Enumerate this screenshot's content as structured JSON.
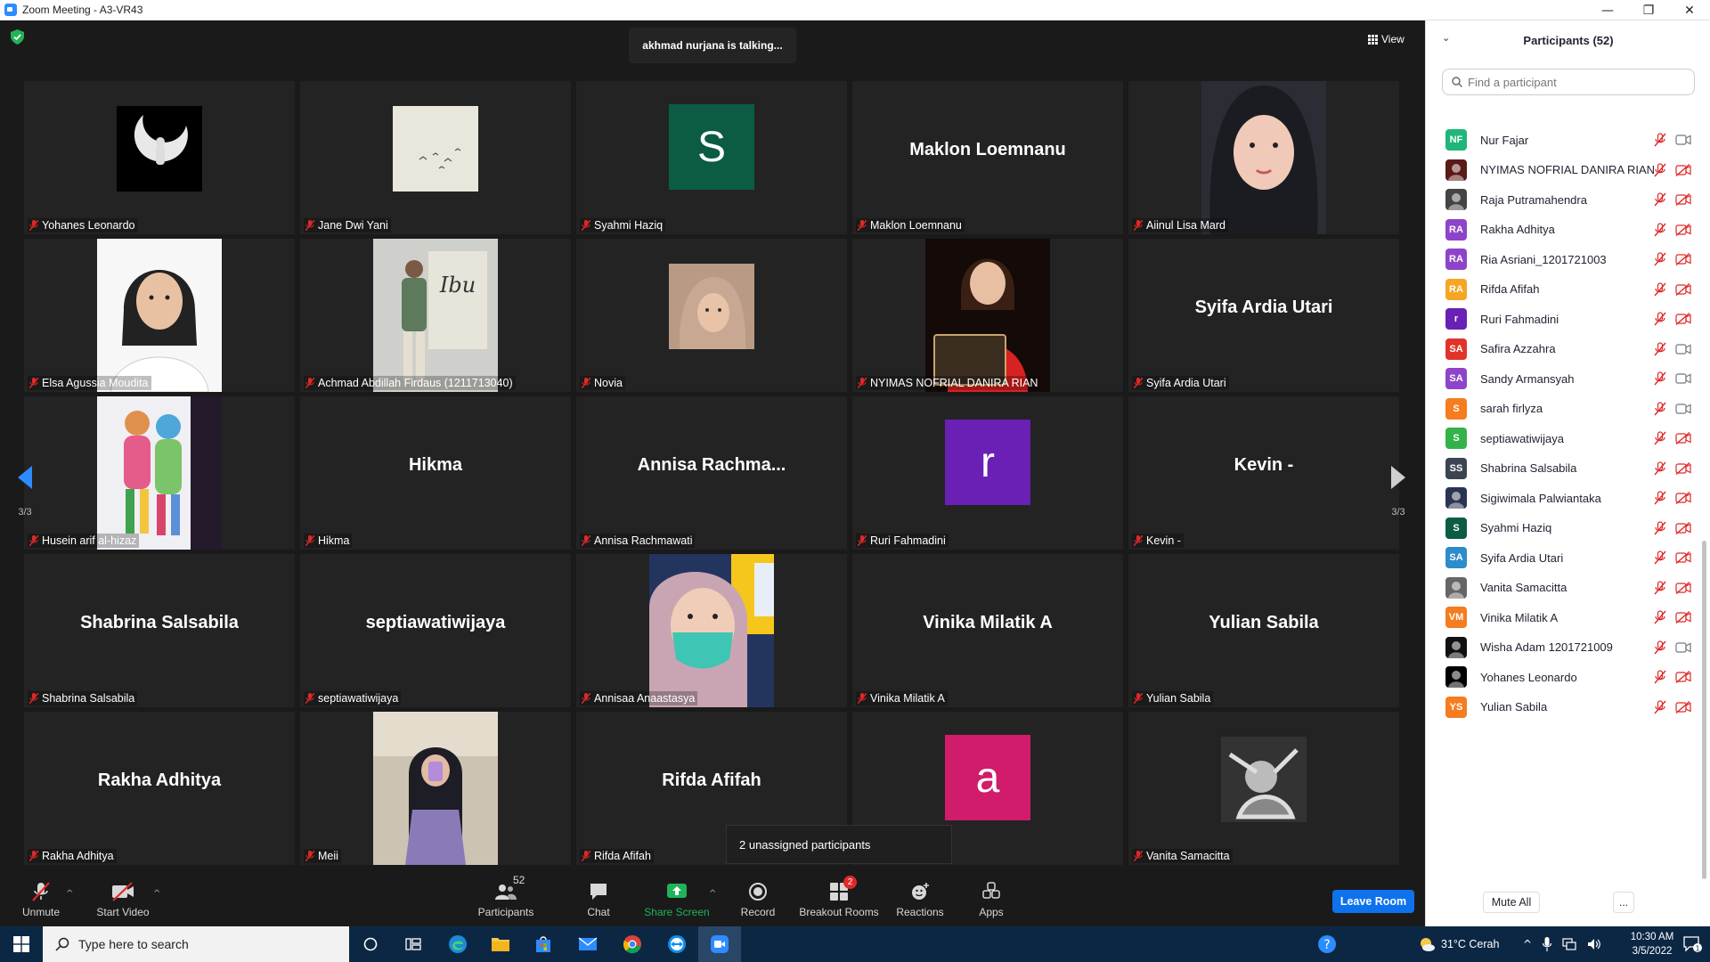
{
  "window": {
    "title": "Zoom Meeting - A3-VR43",
    "controls": [
      "—",
      "❐",
      "✕"
    ]
  },
  "meeting": {
    "talking": "akhmad nurjana is talking...",
    "view_label": "View",
    "page_indicator_left": "3/3",
    "page_indicator_right": "3/3",
    "unassigned_tooltip": "2 unassigned participants"
  },
  "tiles": [
    {
      "label": "Yohanes Leonardo",
      "kind": "thumb",
      "bg": "#000000",
      "art": "moon"
    },
    {
      "label": "Jane Dwi Yani",
      "kind": "thumb",
      "bg": "#e9e6dc",
      "art": "birds"
    },
    {
      "label": "Syahmi Haziq",
      "kind": "letter",
      "letter": "S",
      "bg": "#0b5b45"
    },
    {
      "label": "Maklon Loemnanu",
      "kind": "name",
      "display": "Maklon Loemnanu"
    },
    {
      "label": "Aiinul Lisa Mard",
      "kind": "photo",
      "bg": "#2b2d35",
      "art": "hijab-dark"
    },
    {
      "label": "Elsa Agussia Moudita",
      "kind": "photo",
      "bg": "#f4f4f4",
      "art": "portrait-white"
    },
    {
      "label": "Achmad Abdillah Firdaus (1211713040)",
      "kind": "photo",
      "bg": "#d8d7d0",
      "art": "ibu-poster",
      "poster_text": "Ibu"
    },
    {
      "label": "Novia",
      "kind": "thumb",
      "bg": "#c7a58c",
      "art": "hijab-small"
    },
    {
      "label": "NYIMAS NOFRIAL DANIRA RIAN",
      "kind": "photo",
      "bg": "#1a0d0b",
      "art": "red-dress"
    },
    {
      "label": "Syifa Ardia Utari",
      "kind": "name",
      "display": "Syifa Ardia Utari"
    },
    {
      "label": "Husein arif al-hizaz",
      "kind": "photo",
      "bg": "#2a2233",
      "art": "figures"
    },
    {
      "label": "Hikma",
      "kind": "name",
      "display": "Hikma"
    },
    {
      "label": "Annisa Rachmawati",
      "kind": "name",
      "display": "Annisa  Rachma..."
    },
    {
      "label": "Ruri Fahmadini",
      "kind": "letter",
      "letter": "r",
      "bg": "#6a1fb5"
    },
    {
      "label": "Kevin -",
      "kind": "name",
      "display": "Kevin -"
    },
    {
      "label": "Shabrina Salsabila",
      "kind": "name",
      "display": "Shabrina Salsabila"
    },
    {
      "label": "septiawatiwijaya",
      "kind": "name",
      "display": "septiawatiwijaya"
    },
    {
      "label": "Annisaa Anaastasya",
      "kind": "photo",
      "bg": "#2a3f73",
      "art": "mask"
    },
    {
      "label": "Vinika Milatik A",
      "kind": "name",
      "display": "Vinika Milatik A"
    },
    {
      "label": "Yulian Sabila",
      "kind": "name",
      "display": "Yulian Sabila"
    },
    {
      "label": "Rakha Adhitya",
      "kind": "name",
      "display": "Rakha Adhitya"
    },
    {
      "label": "Meii",
      "kind": "photo",
      "bg": "#cfc5b4",
      "art": "mirror"
    },
    {
      "label": "Rifda Afifah",
      "kind": "name",
      "display": "Rifda Afifah"
    },
    {
      "label": "",
      "kind": "letter",
      "letter": "a",
      "bg": "#d01c6a"
    },
    {
      "label": "Vanita Samacitta",
      "kind": "thumb",
      "bg": "#555555",
      "art": "bw"
    }
  ],
  "toolbar": {
    "unmute": "Unmute",
    "start_video": "Start Video",
    "participants": "Participants",
    "participants_count": "52",
    "chat": "Chat",
    "share_screen": "Share Screen",
    "record": "Record",
    "breakout_rooms": "Breakout Rooms",
    "breakout_badge": "2",
    "reactions": "Reactions",
    "apps": "Apps",
    "leave_room": "Leave Room"
  },
  "panel": {
    "title": "Participants (52)",
    "search_placeholder": "Find a participant",
    "mute_all": "Mute All",
    "more": "...",
    "participants": [
      {
        "name": "Novia",
        "initials": "",
        "color": "#b58a74",
        "cam": "off"
      },
      {
        "name": "Nur Fajar",
        "initials": "NF",
        "color": "#20b57a",
        "cam": "on"
      },
      {
        "name": "NYIMAS NOFRIAL DANIRA RIAN",
        "initials": "",
        "color": "#5a1a18",
        "cam": "off"
      },
      {
        "name": "Raja Putramahendra",
        "initials": "",
        "color": "#444444",
        "cam": "off"
      },
      {
        "name": "Rakha Adhitya",
        "initials": "RA",
        "color": "#8e44c8",
        "cam": "off"
      },
      {
        "name": "Ria Asriani_1201721003",
        "initials": "RA",
        "color": "#8e44c8",
        "cam": "off"
      },
      {
        "name": "Rifda Afifah",
        "initials": "RA",
        "color": "#f5a623",
        "cam": "off"
      },
      {
        "name": "Ruri Fahmadini",
        "initials": "r",
        "color": "#6a1fb5",
        "cam": "off"
      },
      {
        "name": "Safira Azzahra",
        "initials": "SA",
        "color": "#e0342b",
        "cam": "on"
      },
      {
        "name": "Sandy Armansyah",
        "initials": "SA",
        "color": "#8e44c8",
        "cam": "on"
      },
      {
        "name": "sarah firlyza",
        "initials": "S",
        "color": "#f57c1f",
        "cam": "on"
      },
      {
        "name": "septiawatiwijaya",
        "initials": "S",
        "color": "#33b249",
        "cam": "off"
      },
      {
        "name": "Shabrina Salsabila",
        "initials": "SS",
        "color": "#3d4451",
        "cam": "off"
      },
      {
        "name": "Sigiwimala Palwiantaka",
        "initials": "",
        "color": "#2a3550",
        "cam": "off"
      },
      {
        "name": "Syahmi Haziq",
        "initials": "S",
        "color": "#0b5b45",
        "cam": "off"
      },
      {
        "name": "Syifa Ardia Utari",
        "initials": "SA",
        "color": "#2d8cca",
        "cam": "off"
      },
      {
        "name": "Vanita Samacitta",
        "initials": "",
        "color": "#666666",
        "cam": "off"
      },
      {
        "name": "Vinika Milatik A",
        "initials": "VM",
        "color": "#f57c1f",
        "cam": "off"
      },
      {
        "name": "Wisha Adam 1201721009",
        "initials": "",
        "color": "#111111",
        "cam": "on"
      },
      {
        "name": "Yohanes Leonardo",
        "initials": "",
        "color": "#000000",
        "cam": "off"
      },
      {
        "name": "Yulian Sabila",
        "initials": "YS",
        "color": "#f57c1f",
        "cam": "off"
      }
    ]
  },
  "taskbar": {
    "search_placeholder": "Type here to search",
    "weather": "31°C  Cerah",
    "time": "10:30 AM",
    "date": "3/5/2022",
    "notification_count": "1"
  },
  "colors": {
    "accent_blue": "#0e72ed",
    "share_green": "#1fb35a",
    "mic_off_red": "#e02828"
  }
}
